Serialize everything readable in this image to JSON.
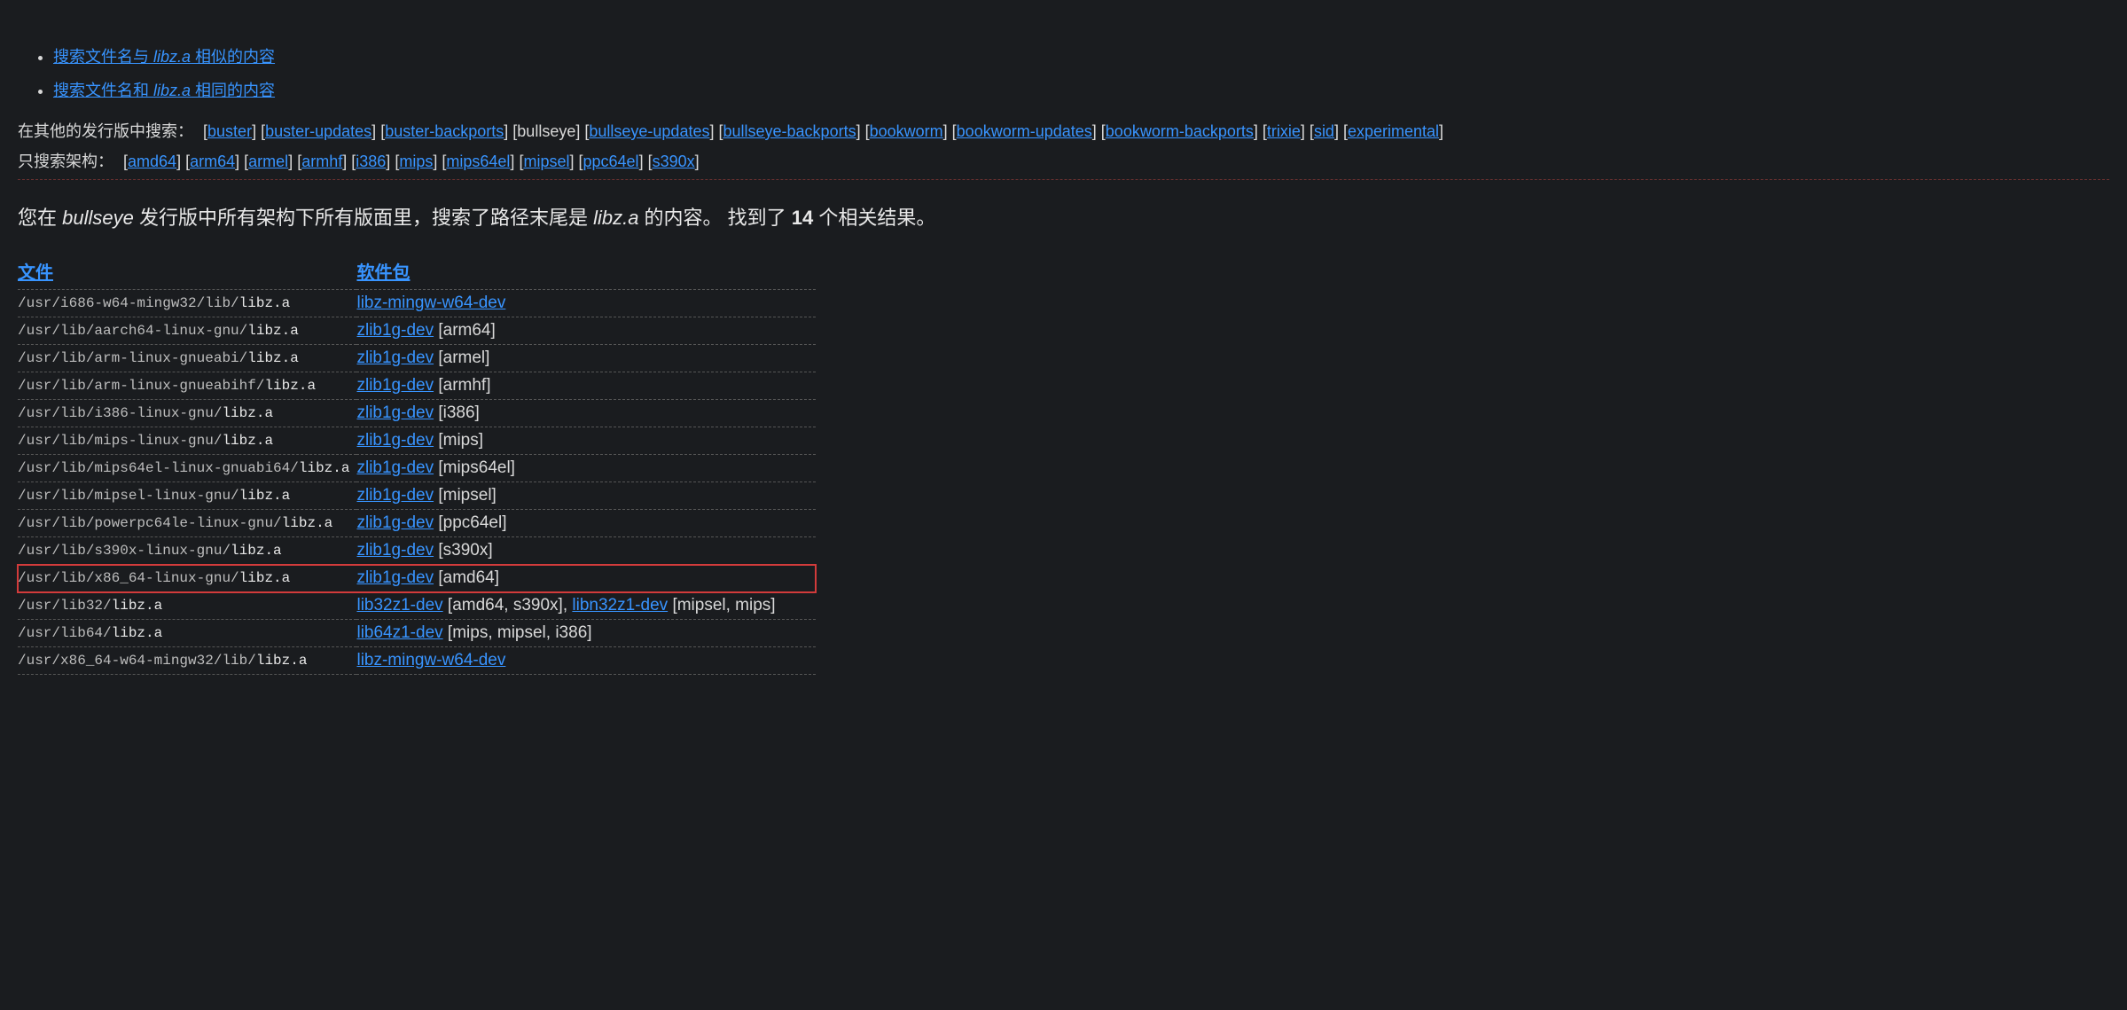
{
  "top_links": [
    {
      "prefix": "搜索文件名与 ",
      "term": "libz.a",
      "suffix": " 相似的内容"
    },
    {
      "prefix": "搜索文件名和 ",
      "term": "libz.a",
      "suffix": " 相同的内容"
    }
  ],
  "dist_label": "在其他的发行版中搜索：",
  "dist_links": [
    "buster",
    "buster-updates",
    "buster-backports",
    "bullseye",
    "bullseye-updates",
    "bullseye-backports",
    "bookworm",
    "bookworm-updates",
    "bookworm-backports",
    "trixie",
    "sid",
    "experimental"
  ],
  "dist_plain_index": 3,
  "arch_label": "只搜索架构：",
  "arch_links": [
    "amd64",
    "arm64",
    "armel",
    "armhf",
    "i386",
    "mips",
    "mips64el",
    "mipsel",
    "ppc64el",
    "s390x"
  ],
  "summary": {
    "p1": "您在 ",
    "dist": "bullseye",
    "p2": " 发行版中所有架构下所有版面里，搜索了路径末尾是 ",
    "term": "libz.a",
    "p3": " 的内容。  找到了 ",
    "count": "14",
    "p4": " 个相关结果。"
  },
  "headers": {
    "file": "文件",
    "pkg": "软件包"
  },
  "rows": [
    {
      "path_pre": "/usr/i686-w64-mingw32/lib/",
      "path_hl": "libz.a",
      "pkgs": [
        {
          "name": "libz-mingw-w64-dev",
          "arch": ""
        }
      ],
      "highlight": false
    },
    {
      "path_pre": "/usr/lib/aarch64-linux-gnu/",
      "path_hl": "libz.a",
      "pkgs": [
        {
          "name": "zlib1g-dev",
          "arch": "[arm64]"
        }
      ],
      "highlight": false
    },
    {
      "path_pre": "/usr/lib/arm-linux-gnueabi/",
      "path_hl": "libz.a",
      "pkgs": [
        {
          "name": "zlib1g-dev",
          "arch": "[armel]"
        }
      ],
      "highlight": false
    },
    {
      "path_pre": "/usr/lib/arm-linux-gnueabihf/",
      "path_hl": "libz.a",
      "pkgs": [
        {
          "name": "zlib1g-dev",
          "arch": "[armhf]"
        }
      ],
      "highlight": false
    },
    {
      "path_pre": "/usr/lib/i386-linux-gnu/",
      "path_hl": "libz.a",
      "pkgs": [
        {
          "name": "zlib1g-dev",
          "arch": "[i386]"
        }
      ],
      "highlight": false
    },
    {
      "path_pre": "/usr/lib/mips-linux-gnu/",
      "path_hl": "libz.a",
      "pkgs": [
        {
          "name": "zlib1g-dev",
          "arch": "[mips]"
        }
      ],
      "highlight": false
    },
    {
      "path_pre": "/usr/lib/mips64el-linux-gnuabi64/",
      "path_hl": "libz.a",
      "pkgs": [
        {
          "name": "zlib1g-dev",
          "arch": "[mips64el]"
        }
      ],
      "highlight": false
    },
    {
      "path_pre": "/usr/lib/mipsel-linux-gnu/",
      "path_hl": "libz.a",
      "pkgs": [
        {
          "name": "zlib1g-dev",
          "arch": "[mipsel]"
        }
      ],
      "highlight": false
    },
    {
      "path_pre": "/usr/lib/powerpc64le-linux-gnu/",
      "path_hl": "libz.a",
      "pkgs": [
        {
          "name": "zlib1g-dev",
          "arch": "[ppc64el]"
        }
      ],
      "highlight": false
    },
    {
      "path_pre": "/usr/lib/s390x-linux-gnu/",
      "path_hl": "libz.a",
      "pkgs": [
        {
          "name": "zlib1g-dev",
          "arch": "[s390x]"
        }
      ],
      "highlight": false
    },
    {
      "path_pre": "/usr/lib/x86_64-linux-gnu/",
      "path_hl": "libz.a",
      "pkgs": [
        {
          "name": "zlib1g-dev",
          "arch": "[amd64]"
        }
      ],
      "highlight": true
    },
    {
      "path_pre": "/usr/lib32/",
      "path_hl": "libz.a",
      "pkgs": [
        {
          "name": "lib32z1-dev",
          "arch": "[amd64, s390x]"
        },
        {
          "name": "libn32z1-dev",
          "arch": "[mipsel, mips]"
        }
      ],
      "highlight": false
    },
    {
      "path_pre": "/usr/lib64/",
      "path_hl": "libz.a",
      "pkgs": [
        {
          "name": "lib64z1-dev",
          "arch": "[mips, mipsel, i386]"
        }
      ],
      "highlight": false
    },
    {
      "path_pre": "/usr/x86_64-w64-mingw32/lib/",
      "path_hl": "libz.a",
      "pkgs": [
        {
          "name": "libz-mingw-w64-dev",
          "arch": ""
        }
      ],
      "highlight": false
    }
  ]
}
